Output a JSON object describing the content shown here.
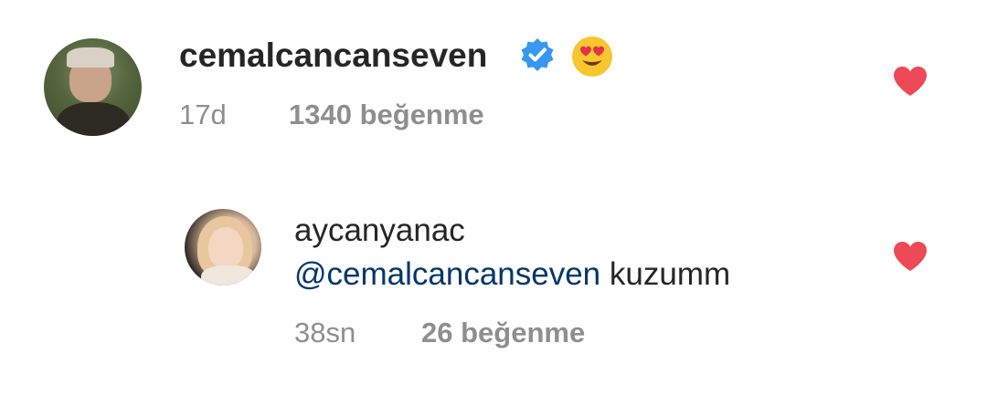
{
  "comments": [
    {
      "username": "cemalcancanseven",
      "verified": true,
      "emoji": "heart-eyes-emoji",
      "time": "17d",
      "likes": "1340 beğenme",
      "liked": true
    },
    {
      "username": "aycanyanac",
      "mention": "@cemalcancanseven",
      "text": "kuzumm",
      "time": "38sn",
      "likes": "26 beğenme",
      "liked": true
    }
  ],
  "colors": {
    "heart": "#ed4956",
    "verified": "#3897f0",
    "mention": "#00376b",
    "meta": "#8e8e8e",
    "text": "#262626"
  }
}
